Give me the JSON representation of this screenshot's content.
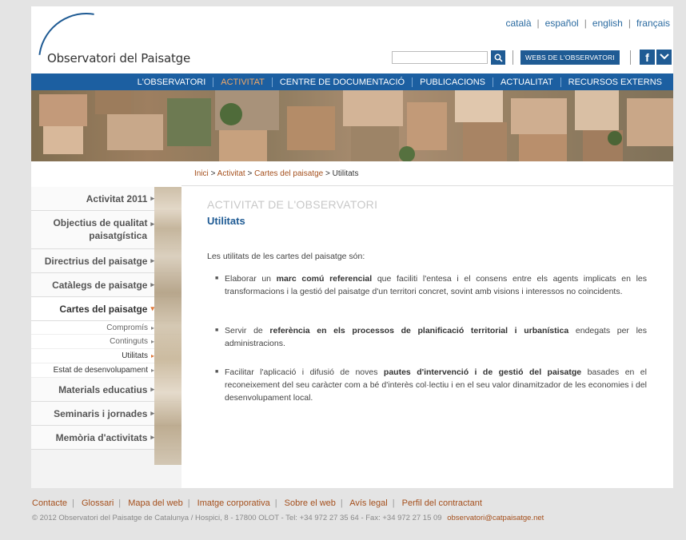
{
  "header": {
    "logo_text": "Observatori del Paisatge",
    "languages": [
      "català",
      "español",
      "english",
      "français"
    ],
    "search_placeholder": "",
    "webs_button": "WEBS DE L'OBSERVATORI",
    "facebook_glyph": "f",
    "twitter_glyph": "❯"
  },
  "nav": {
    "items": [
      "L'OBSERVATORI",
      "ACTIVITAT",
      "CENTRE DE DOCUMENTACIÓ",
      "PUBLICACIONS",
      "ACTUALITAT",
      "RECURSOS EXTERNS"
    ],
    "active_index": 1
  },
  "breadcrumb": {
    "items": [
      "Inici",
      "Activitat",
      "Cartes del paisatge",
      "Utilitats"
    ],
    "separator": ">"
  },
  "sidebar": {
    "items": [
      {
        "label": "Activitat 2011"
      },
      {
        "label_line1": "Objectius de qualitat",
        "label_line2": "paisatgística"
      },
      {
        "label": "Directrius del paisatge"
      },
      {
        "label": "Catàlegs de paisatge"
      },
      {
        "label": "Cartes del paisatge"
      },
      {
        "label": "Materials educatius"
      },
      {
        "label": "Seminaris i jornades"
      },
      {
        "label": "Memòria d'activitats"
      }
    ],
    "subitems": [
      "Compromís",
      "Continguts",
      "Utilitats",
      "Estat de desenvolupament"
    ],
    "active_subitem": 2
  },
  "content": {
    "kicker": "ACTIVITAT DE L'OBSERVATORI",
    "title": "Utilitats",
    "intro": "Les utilitats de les cartes del paisatge són:",
    "bullets": [
      {
        "pre": "Elaborar un ",
        "bold": "marc comú referencial",
        "post": " que faciliti l'entesa i el consens entre els agents implicats en les transformacions i la gestió del paisatge d'un territori concret, sovint amb visions i interessos no coincidents."
      },
      {
        "pre": "Servir de ",
        "bold": "referència en els processos de planificació territorial i urbanística",
        "post": " endegats per les administracions."
      },
      {
        "pre": "Facilitar l'aplicació i difusió de noves ",
        "bold": "pautes d'intervenció i de gestió del paisatge",
        "post": " basades en el reconeixement del seu caràcter com a bé d'interès col·lectiu i en el seu valor dinamitzador de les economies i del desenvolupament local."
      }
    ]
  },
  "footer": {
    "links": [
      "Contacte",
      "Glossari",
      "Mapa del web",
      "Imatge corporativa",
      "Sobre el web",
      "Avís legal",
      "Perfil del contractant"
    ],
    "copyright": "© 2012 Observatori del Paisatge de Catalunya / Hospici, 8 - 17800 OLOT - Tel: +34 972 27 35 64 - Fax: +34 972 27 15 09",
    "email": "observatori@catpaisatge.net"
  },
  "colors": {
    "brand_blue": "#1c5fa1",
    "link_orange": "#a44f1c",
    "active_nav": "#f0a868"
  }
}
